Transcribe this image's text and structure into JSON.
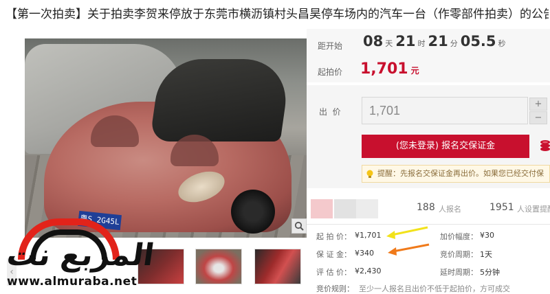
{
  "page": {
    "title": "【第一次拍卖】关于拍卖李贺来停放于东莞市横沥镇村头昌昊停车场内的汽车一台（作零部件拍卖）的公告"
  },
  "gallery": {
    "plate_text": "粤S 2G45L",
    "thumbnails": [
      "thumb-interior",
      "thumb-engine",
      "thumb-seats"
    ]
  },
  "watermark": {
    "arabic_text": "المربع نت",
    "url": "www.almuraba.net"
  },
  "countdown": {
    "label": "距开始",
    "days": "08",
    "days_unit": "天",
    "hours": "21",
    "hours_unit": "时",
    "minutes": "21",
    "minutes_unit": "分",
    "seconds": "05.5",
    "seconds_unit": "秒"
  },
  "start_price": {
    "label": "起拍价",
    "value": "1,701",
    "unit": "元"
  },
  "bid": {
    "label": "出  价",
    "value": "1,701",
    "plus": "+",
    "minus": "−",
    "signup_button": "(您未登录) 报名交保证金",
    "notice": "提醒：先报名交保证金再出价。如果您已经交付保"
  },
  "stats": {
    "signup_count": "188",
    "signup_label": "人报名",
    "reminder_count": "1951",
    "reminder_label": "人设置提醒"
  },
  "info": {
    "start_price_label": "起 拍 价：",
    "start_price_value": "¥1,701",
    "increment_label": "加价幅度：",
    "increment_value": "¥30",
    "deposit_label": "保 证 金：",
    "deposit_value": "¥340",
    "period_label": "竞价周期：",
    "period_value": "1天",
    "appraisal_label": "评 估 价：",
    "appraisal_value": "¥2,430",
    "delay_label": "延时周期：",
    "delay_value": "5分钟",
    "rule_label": "竞价规则：",
    "rule_value": "至少一人报名且出价不低于起拍价，方可成交"
  },
  "colors": {
    "accent": "#c8102e",
    "arrow_yellow": "#f2e21b",
    "arrow_orange": "#f07a1a"
  }
}
